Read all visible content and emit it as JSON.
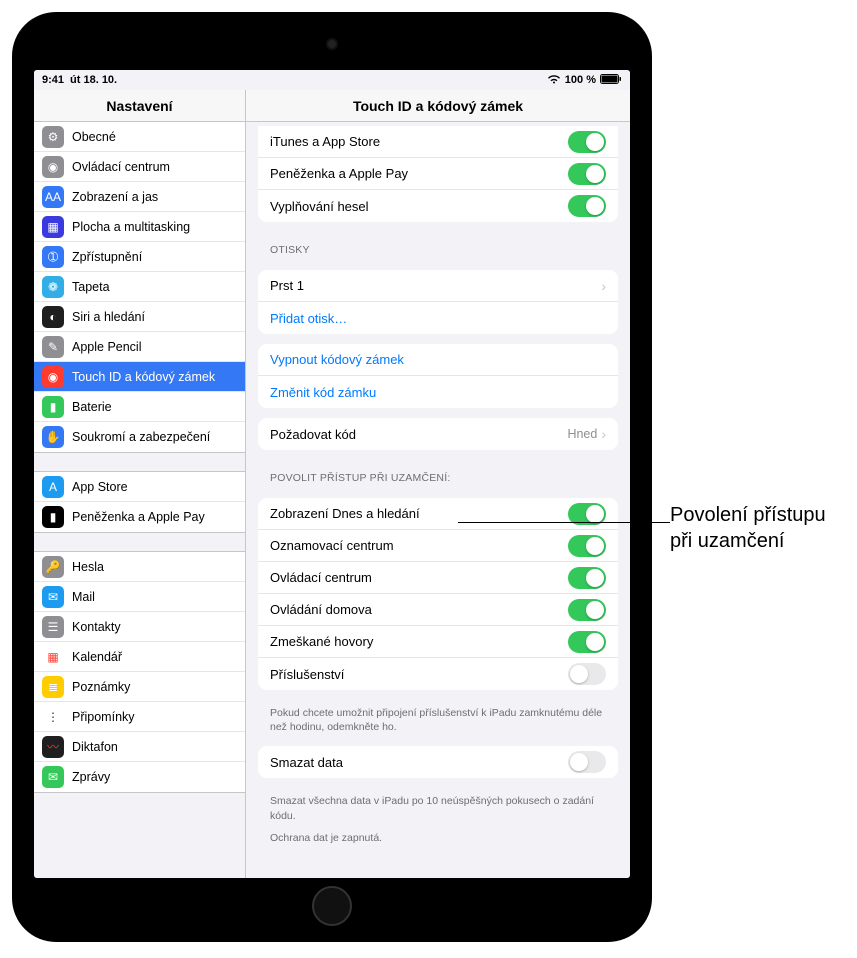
{
  "status": {
    "time": "9:41",
    "date": "út 18. 10.",
    "battery_text": "100 %"
  },
  "sidebar": {
    "title": "Nastavení",
    "groups": [
      {
        "items": [
          {
            "label": "Obecné",
            "icon_bg": "#8e8e93",
            "icon_glyph": "⚙",
            "name": "general"
          },
          {
            "label": "Ovládací centrum",
            "icon_bg": "#8e8e93",
            "icon_glyph": "◉",
            "name": "control-center"
          },
          {
            "label": "Zobrazení a jas",
            "icon_bg": "#3478f6",
            "icon_glyph": "AA",
            "name": "display"
          },
          {
            "label": "Plocha a multitasking",
            "icon_bg": "#3a3adf",
            "icon_glyph": "▦",
            "name": "home-multitask"
          },
          {
            "label": "Zpřístupnění",
            "icon_bg": "#3478f6",
            "icon_glyph": "➀",
            "name": "accessibility"
          },
          {
            "label": "Tapeta",
            "icon_bg": "#32ade6",
            "icon_glyph": "❁",
            "name": "wallpaper"
          },
          {
            "label": "Siri a hledání",
            "icon_bg": "#1f1f1f",
            "icon_glyph": "◐",
            "name": "siri"
          },
          {
            "label": "Apple Pencil",
            "icon_bg": "#8e8e93",
            "icon_glyph": "✎",
            "name": "pencil"
          },
          {
            "label": "Touch ID a kódový zámek",
            "icon_bg": "#ff3b30",
            "icon_glyph": "◉",
            "name": "touchid",
            "selected": true
          },
          {
            "label": "Baterie",
            "icon_bg": "#34c759",
            "icon_glyph": "▮",
            "name": "battery"
          },
          {
            "label": "Soukromí a zabezpečení",
            "icon_bg": "#3478f6",
            "icon_glyph": "✋",
            "name": "privacy"
          }
        ]
      },
      {
        "items": [
          {
            "label": "App Store",
            "icon_bg": "#1d9bf0",
            "icon_glyph": "A",
            "name": "appstore"
          },
          {
            "label": "Peněženka a Apple Pay",
            "icon_bg": "#000",
            "icon_glyph": "▮",
            "name": "wallet"
          }
        ]
      },
      {
        "items": [
          {
            "label": "Hesla",
            "icon_bg": "#8e8e93",
            "icon_glyph": "🔑",
            "name": "passwords"
          },
          {
            "label": "Mail",
            "icon_bg": "#1d9bf0",
            "icon_glyph": "✉",
            "name": "mail"
          },
          {
            "label": "Kontakty",
            "icon_bg": "#8e8e93",
            "icon_glyph": "☰",
            "name": "contacts"
          },
          {
            "label": "Kalendář",
            "icon_bg": "#fff",
            "icon_glyph": "▦",
            "name": "calendar",
            "icon_fg": "#ff3b30"
          },
          {
            "label": "Poznámky",
            "icon_bg": "#ffcc00",
            "icon_glyph": "≣",
            "name": "notes"
          },
          {
            "label": "Připomínky",
            "icon_bg": "#fff",
            "icon_glyph": "⋮",
            "name": "reminders",
            "icon_fg": "#333"
          },
          {
            "label": "Diktafon",
            "icon_bg": "#1f1f1f",
            "icon_glyph": "〰",
            "name": "voicememos",
            "icon_fg": "#ff3b30"
          },
          {
            "label": "Zprávy",
            "icon_bg": "#34c759",
            "icon_glyph": "✉",
            "name": "messages"
          }
        ]
      }
    ]
  },
  "detail": {
    "title": "Touch ID a kódový zámek",
    "top_toggles": [
      {
        "label": "iTunes a App Store",
        "on": true,
        "name": "toggle-itunes"
      },
      {
        "label": "Peněženka a Apple Pay",
        "on": true,
        "name": "toggle-wallet"
      },
      {
        "label": "Vyplňování hesel",
        "on": true,
        "name": "toggle-autofill"
      }
    ],
    "fingerprints": {
      "header": "OTISKY",
      "finger_label": "Prst 1",
      "add_label": "Přidat otisk…"
    },
    "passcode": {
      "turn_off": "Vypnout kódový zámek",
      "change": "Změnit kód zámku"
    },
    "require": {
      "label": "Požadovat kód",
      "value": "Hned"
    },
    "lock_access": {
      "header": "POVOLIT PŘÍSTUP PŘI UZAMČENÍ:",
      "items": [
        {
          "label": "Zobrazení Dnes a hledání",
          "on": true,
          "name": "toggle-today"
        },
        {
          "label": "Oznamovací centrum",
          "on": true,
          "name": "toggle-notifications"
        },
        {
          "label": "Ovládací centrum",
          "on": true,
          "name": "toggle-controlcenter"
        },
        {
          "label": "Ovládání domova",
          "on": true,
          "name": "toggle-home"
        },
        {
          "label": "Zmeškané hovory",
          "on": true,
          "name": "toggle-missedcalls"
        },
        {
          "label": "Příslušenství",
          "on": false,
          "name": "toggle-accessories"
        }
      ],
      "footer": "Pokud chcete umožnit připojení příslušenství k iPadu zamknutému déle než hodinu, odemkněte ho."
    },
    "erase": {
      "label": "Smazat data",
      "on": false,
      "footer1": "Smazat všechna data v iPadu po 10 neúspěšných pokusech o zadání kódu.",
      "footer2": "Ochrana dat je zapnutá."
    }
  },
  "callout": "Povolení přístupu při uzamčení"
}
